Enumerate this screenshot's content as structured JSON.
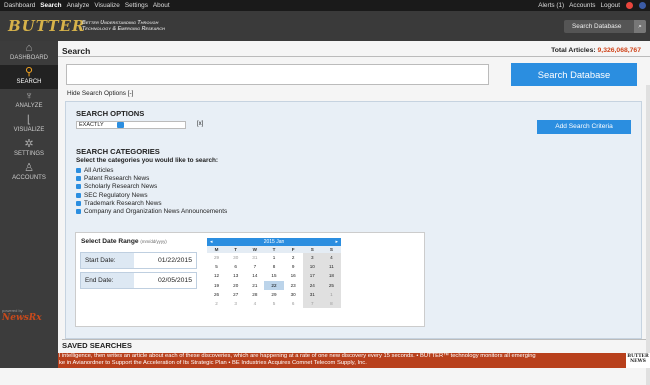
{
  "topnav": {
    "items": [
      "Dashboard",
      "Search",
      "Analyze",
      "Visualize",
      "Settings",
      "About"
    ],
    "active": "Search",
    "alerts": "Alerts (1)",
    "accounts": "Accounts",
    "logout": "Logout"
  },
  "header": {
    "logo": "BUTTER",
    "tagline1": "Better Understanding Through",
    "tagline2": "Technology & Emerging Research",
    "search_label": "Search Database",
    "search_icon": "search-icon"
  },
  "sidebar": {
    "items": [
      {
        "label": "DASHBOARD",
        "icon": "home-icon"
      },
      {
        "label": "SEARCH",
        "icon": "search-icon"
      },
      {
        "label": "ANALYZE",
        "icon": "microscope-icon"
      },
      {
        "label": "VISUALIZE",
        "icon": "chart-icon"
      },
      {
        "label": "SETTINGS",
        "icon": "gears-icon"
      },
      {
        "label": "ACCOUNTS",
        "icon": "users-icon"
      }
    ],
    "powered_by": "powered by",
    "newsrx": "NewsRx"
  },
  "main": {
    "title": "Search",
    "total_label": "Total Articles:",
    "total_value": "9,326,068,767",
    "search_button": "Search Database",
    "hide_options": "Hide Search Options [-]",
    "options_heading": "SEARCH OPTIONS",
    "match_mode": "EXACTLY",
    "remove": "[x]",
    "add_criteria": "Add Search Criteria",
    "categories_heading": "SEARCH CATEGORIES",
    "categories_prompt": "Select the categories you would like to search:",
    "categories": [
      "All Articles",
      "Patent Research News",
      "Scholarly Research News",
      "SEC Regulatory News",
      "Trademark Research News",
      "Company and Organization News Announcements"
    ],
    "date_heading": "Select Date Range",
    "date_format": "(mm/dd/yyyy)",
    "start_label": "Start Date:",
    "start_value": "01/22/2015",
    "end_label": "End Date:",
    "end_value": "02/05/2015",
    "saved_heading": "SAVED SEARCHES"
  },
  "calendar": {
    "month_label": "2015 Jan",
    "prev": "◂",
    "next": "▸",
    "day_headers": [
      "M",
      "T",
      "W",
      "T",
      "F",
      "S",
      "S"
    ],
    "weeks": [
      [
        "29",
        "30",
        "31",
        "1",
        "2",
        "3",
        "4"
      ],
      [
        "5",
        "6",
        "7",
        "8",
        "9",
        "10",
        "11"
      ],
      [
        "12",
        "13",
        "14",
        "15",
        "16",
        "17",
        "18"
      ],
      [
        "19",
        "20",
        "21",
        "22",
        "23",
        "24",
        "25"
      ],
      [
        "26",
        "27",
        "28",
        "29",
        "30",
        "31",
        "1"
      ],
      [
        "2",
        "3",
        "4",
        "5",
        "6",
        "7",
        "8"
      ]
    ],
    "selected": "22"
  },
  "ticker": {
    "line1": "l intelligence, then writes an article about each of these discoveries, which are happening at a rate of one new discovery every 15 seconds. • BUTTER™ technology monitors all emerging",
    "line2": "ke in Avianordner to Support the Acceleration of Its Strategic Plan • BE Industries Acquires Comnet Telecom Supply, Inc.",
    "logo": "BUTTER NEWS"
  }
}
